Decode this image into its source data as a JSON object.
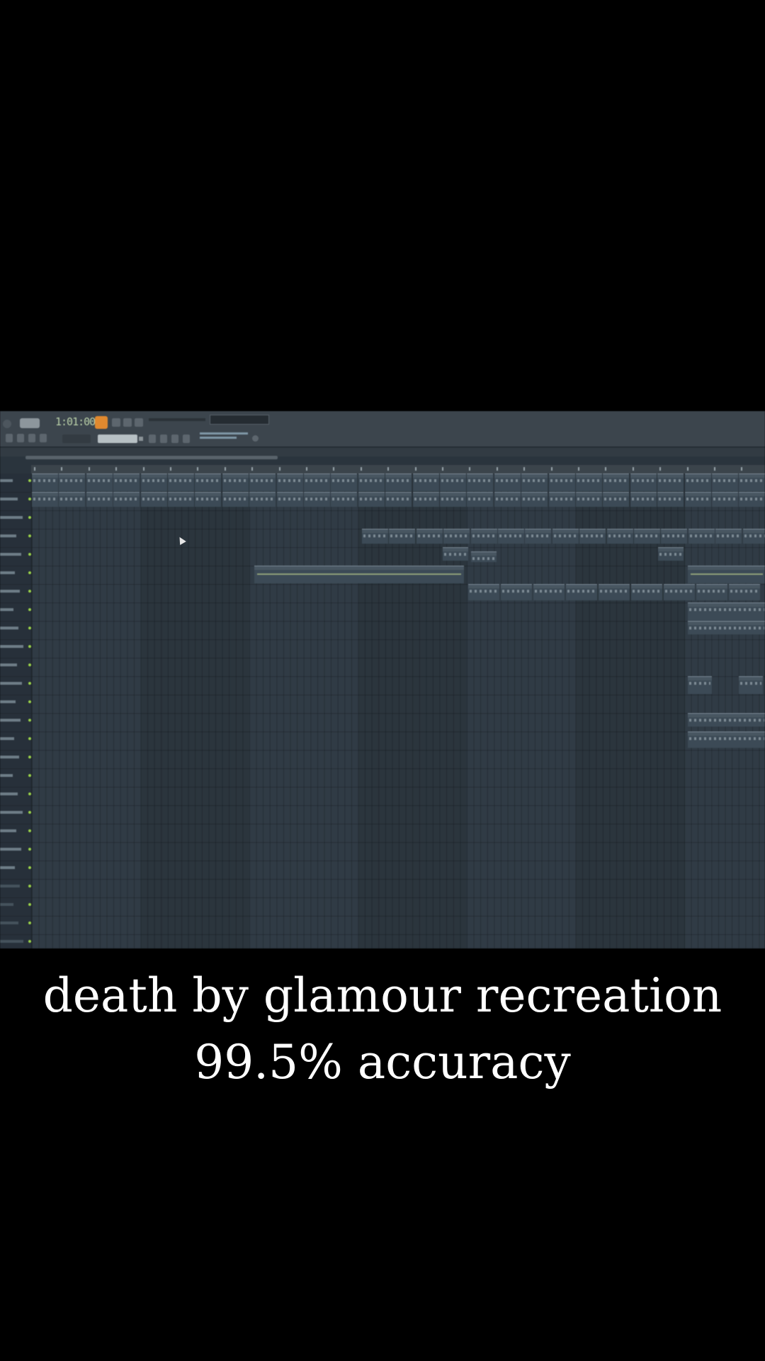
{
  "transport": {
    "time": "1:01:00"
  },
  "caption": {
    "line1": "death by glamour recreation",
    "line2": "99.5% accuracy"
  },
  "colors": {
    "background": "#000000",
    "app_bg": "#2a343d",
    "record_accent": "#e0892f",
    "track_led": "#9bd34a",
    "caption_text": "#ffffff"
  },
  "icons": [
    "cursor-arrow-icon",
    "record-icon"
  ]
}
